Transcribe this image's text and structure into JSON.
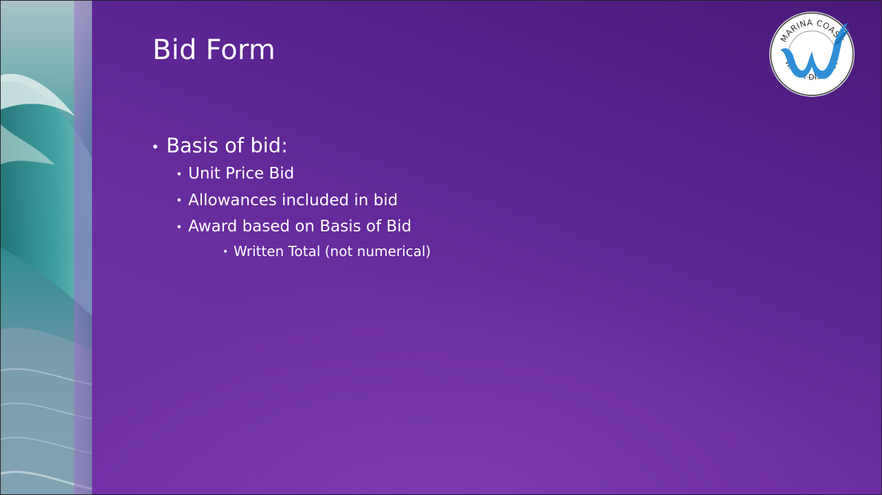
{
  "slide": {
    "title": "Bid Form",
    "logo": {
      "text_top": "MARINA COAST",
      "text_bottom": "WATER DISTRICT",
      "icon": "water-drop-w-logo",
      "color": "#2f8fd6"
    },
    "bullets": [
      {
        "level": 1,
        "text": "Basis of bid:"
      },
      {
        "level": 2,
        "text": "Unit Price Bid"
      },
      {
        "level": 2,
        "text": "Allowances included in bid"
      },
      {
        "level": 2,
        "text": "Award based on Basis of Bid"
      },
      {
        "level": 3,
        "text": "Written Total (not numerical)"
      }
    ],
    "bullet_glyph": "•"
  },
  "colors": {
    "background": "#6b2da0",
    "text": "#ffffff",
    "accent": "#2f8fd6"
  }
}
